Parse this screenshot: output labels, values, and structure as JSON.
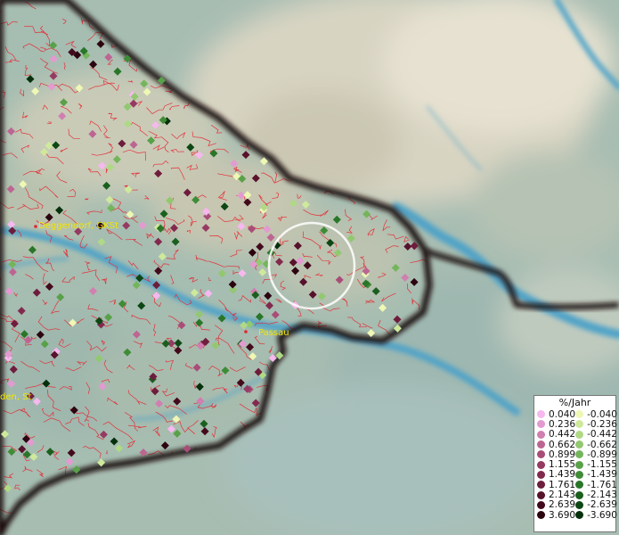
{
  "map": {
    "places": [
      {
        "name": "Deggendorf, GKSt"
      },
      {
        "name": "Passau"
      },
      {
        "name": "den, St"
      }
    ],
    "colors": {
      "border": "#1b0f0d",
      "district_lines": "#e8232e",
      "river": "#4fa3c8",
      "highlight_circle": "#ffffff",
      "place_label": "#f2e600"
    }
  },
  "legend": {
    "title": "%/Jahr",
    "positive": [
      {
        "label": "0.040",
        "color": "#f6b8ee"
      },
      {
        "label": "0.236",
        "color": "#e39ad0"
      },
      {
        "label": "0.442",
        "color": "#d07fb0"
      },
      {
        "label": "0.662",
        "color": "#bd6592"
      },
      {
        "label": "0.899",
        "color": "#a84d78"
      },
      {
        "label": "1.155",
        "color": "#953a62"
      },
      {
        "label": "1.439",
        "color": "#822a4e"
      },
      {
        "label": "1.761",
        "color": "#6e1d3c"
      },
      {
        "label": "2.143",
        "color": "#58122b"
      },
      {
        "label": "2.639",
        "color": "#430a1c"
      },
      {
        "label": "3.690",
        "color": "#2c0410"
      }
    ],
    "negative": [
      {
        "label": "-0.040",
        "color": "#eef7b4"
      },
      {
        "label": "-0.236",
        "color": "#cfe99c"
      },
      {
        "label": "-0.442",
        "color": "#b0d986"
      },
      {
        "label": "-0.662",
        "color": "#92c870"
      },
      {
        "label": "-0.899",
        "color": "#74b55b"
      },
      {
        "label": "-1.155",
        "color": "#58a148"
      },
      {
        "label": "-1.439",
        "color": "#3f8c37"
      },
      {
        "label": "-1.761",
        "color": "#2a7629"
      },
      {
        "label": "-2.143",
        "color": "#1a5f1e"
      },
      {
        "label": "-2.639",
        "color": "#0d4714"
      },
      {
        "label": "-3.690",
        "color": "#05300c"
      }
    ]
  }
}
